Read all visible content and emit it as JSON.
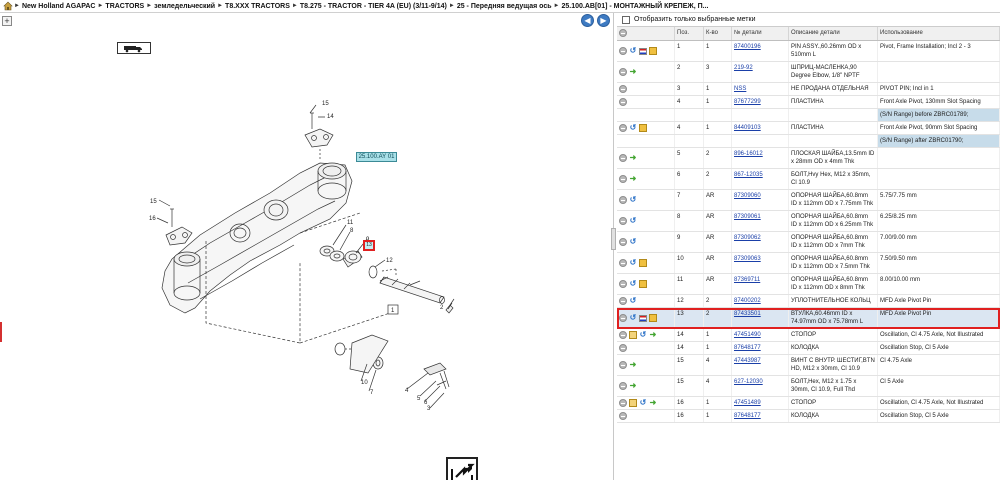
{
  "breadcrumb": [
    "New Holland AGAPAC",
    "TRACTORS",
    "земледельческий",
    "T8.XXX TRACTORS",
    "T8.275 - TRACTOR - TIER 4A (EU) (3/11-9/14)",
    "25 - Передняя ведущая ось",
    "25.100.AB[01] - МОНТАЖНЫЙ КРЕПЕЖ, П..."
  ],
  "left_pane": {
    "plus_label": "+",
    "ref_tag": "25.100.AY 01",
    "highlight_callout": "13",
    "callouts": [
      "15",
      "14",
      "15",
      "16",
      "11",
      "8",
      "9",
      "12",
      "1",
      "2",
      "10",
      "7",
      "4",
      "5",
      "6",
      "3"
    ]
  },
  "right_pane": {
    "filter_label": "Отобразить только выбранные метки",
    "columns": {
      "pos": "Поз.",
      "qty": "К-во",
      "part": "№ детали",
      "desc": "Описание детали",
      "use": "Использование"
    },
    "rows": [
      {
        "icons": [
          "circle",
          "blue",
          "flag",
          "box"
        ],
        "pos": "1",
        "qty": "1",
        "part": "87400196",
        "desc": "PIN ASSY.,60.26mm OD x 510mm L",
        "use": "Pivot, Frame Installation; Incl 2 - 3",
        "shaded": false,
        "selected": false
      },
      {
        "icons": [
          "circle",
          "green"
        ],
        "pos": "2",
        "qty": "3",
        "part": "219-92",
        "desc": "ШПРИЦ-МАСЛЕНКА,90 Degree Elbow, 1/8\" NPTF",
        "use": "",
        "shaded": false,
        "selected": false
      },
      {
        "icons": [
          "circle"
        ],
        "pos": "3",
        "qty": "1",
        "part": "NSS",
        "desc": "НЕ ПРОДАНА ОТДЕЛЬНАЯ",
        "use": "PIVOT PIN; Incl in 1",
        "shaded": false,
        "selected": false
      },
      {
        "icons": [
          "circle"
        ],
        "pos": "4",
        "qty": "1",
        "part": "87677299",
        "desc": "ПЛАСТИНА",
        "use": "Front Axle Pivot, 130mm Slot Spacing",
        "shaded": false,
        "selected": false
      },
      {
        "icons": [],
        "pos": "",
        "qty": "",
        "part": "",
        "desc": "",
        "use": "(S/N Range) before ZBRC01789;",
        "shaded": true,
        "selected": false
      },
      {
        "icons": [
          "circle",
          "blue",
          "box"
        ],
        "pos": "4",
        "qty": "1",
        "part": "84409103",
        "desc": "ПЛАСТИНА",
        "use": "Front Axle Pivot, 90mm Slot Spacing",
        "shaded": false,
        "selected": false
      },
      {
        "icons": [],
        "pos": "",
        "qty": "",
        "part": "",
        "desc": "",
        "use": "(S/N Range) after ZBRC01790;",
        "shaded": true,
        "selected": false
      },
      {
        "icons": [
          "circle",
          "green"
        ],
        "pos": "5",
        "qty": "2",
        "part": "896-16012",
        "desc": "ПЛОСКАЯ ШАЙБА,13.5mm ID x 28mm OD x 4mm Thk",
        "use": "",
        "shaded": false,
        "selected": false
      },
      {
        "icons": [
          "circle",
          "green"
        ],
        "pos": "6",
        "qty": "2",
        "part": "867-12035",
        "desc": "БОЛТ,Hvy Hex, M12 x 35mm, Cl 10.9",
        "use": "",
        "shaded": false,
        "selected": false
      },
      {
        "icons": [
          "circle",
          "blue"
        ],
        "pos": "7",
        "qty": "AR",
        "part": "87309060",
        "desc": "ОПОРНАЯ ШАЙБА,60.8mm ID x 112mm OD x 7.75mm Thk",
        "use": "5.75/7.75 mm",
        "shaded": false,
        "selected": false
      },
      {
        "icons": [
          "circle",
          "blue"
        ],
        "pos": "8",
        "qty": "AR",
        "part": "87309061",
        "desc": "ОПОРНАЯ ШАЙБА,60.8mm ID x 112mm OD x 6.25mm Thk",
        "use": "6.25/8.25 mm",
        "shaded": false,
        "selected": false
      },
      {
        "icons": [
          "circle",
          "blue"
        ],
        "pos": "9",
        "qty": "AR",
        "part": "87309062",
        "desc": "ОПОРНАЯ ШАЙБА,60.8mm ID x 112mm OD x 7mm Thk",
        "use": "7.00/9.00 mm",
        "shaded": false,
        "selected": false
      },
      {
        "icons": [
          "circle",
          "blue",
          "box"
        ],
        "pos": "10",
        "qty": "AR",
        "part": "87309063",
        "desc": "ОПОРНАЯ ШАЙБА,60.8mm ID x 112mm OD x 7.5mm Thk",
        "use": "7.50/9.50 mm",
        "shaded": false,
        "selected": false
      },
      {
        "icons": [
          "circle",
          "blue",
          "box"
        ],
        "pos": "11",
        "qty": "AR",
        "part": "87369711",
        "desc": "ОПОРНАЯ ШАЙБА,60.8mm ID x 112mm OD x 8mm Thk",
        "use": "8.00/10.00 mm",
        "shaded": false,
        "selected": false
      },
      {
        "icons": [
          "circle",
          "blue"
        ],
        "pos": "12",
        "qty": "2",
        "part": "87400202",
        "desc": "УПЛОТНИТЕЛЬНОЕ КОЛЬЦ",
        "use": "MFD Axle Pivot Pin",
        "shaded": false,
        "selected": false
      },
      {
        "icons": [
          "circle",
          "blue",
          "flag",
          "box"
        ],
        "pos": "13",
        "qty": "2",
        "part": "87433501",
        "desc": "ВТУЛКА,60.46mm ID x 74.97mm OD x 75.78mm L",
        "use": "MFD Axle Pivot Pin",
        "shaded": false,
        "selected": true
      },
      {
        "icons": [
          "circle",
          "env",
          "blue",
          "green"
        ],
        "pos": "14",
        "qty": "1",
        "part": "47451490",
        "desc": "СТОПОР",
        "use": "Oscillation, Cl 4.75 Axle, Not Illustrated",
        "shaded": false,
        "selected": false
      },
      {
        "icons": [
          "circle"
        ],
        "pos": "14",
        "qty": "1",
        "part": "87648177",
        "desc": "КОЛОДКА",
        "use": "Oscillation Stop, Cl 5 Axle",
        "shaded": false,
        "selected": false
      },
      {
        "icons": [
          "circle",
          "green"
        ],
        "pos": "15",
        "qty": "4",
        "part": "47443987",
        "desc": "ВИНТ С ВНУТР. ШЕСТИГ,BTN HD, M12 x 30mm, Cl 10.9",
        "use": "Cl 4.75 Axle",
        "shaded": false,
        "selected": false
      },
      {
        "icons": [
          "circle",
          "green"
        ],
        "pos": "15",
        "qty": "4",
        "part": "627-12030",
        "desc": "БОЛТ,Hex, M12 x 1.75 x 30mm, Cl 10.9, Full Thd",
        "use": "Cl 5 Axle",
        "shaded": false,
        "selected": false
      },
      {
        "icons": [
          "circle",
          "env",
          "blue",
          "green"
        ],
        "pos": "16",
        "qty": "1",
        "part": "47451489",
        "desc": "СТОПОР",
        "use": "Oscillation, Cl 4.75 Axle, Not Illustrated",
        "shaded": false,
        "selected": false
      },
      {
        "icons": [
          "circle"
        ],
        "pos": "16",
        "qty": "1",
        "part": "87648177",
        "desc": "КОЛОДКА",
        "use": "Oscillation Stop, Cl 5 Axle",
        "shaded": false,
        "selected": false
      }
    ]
  }
}
